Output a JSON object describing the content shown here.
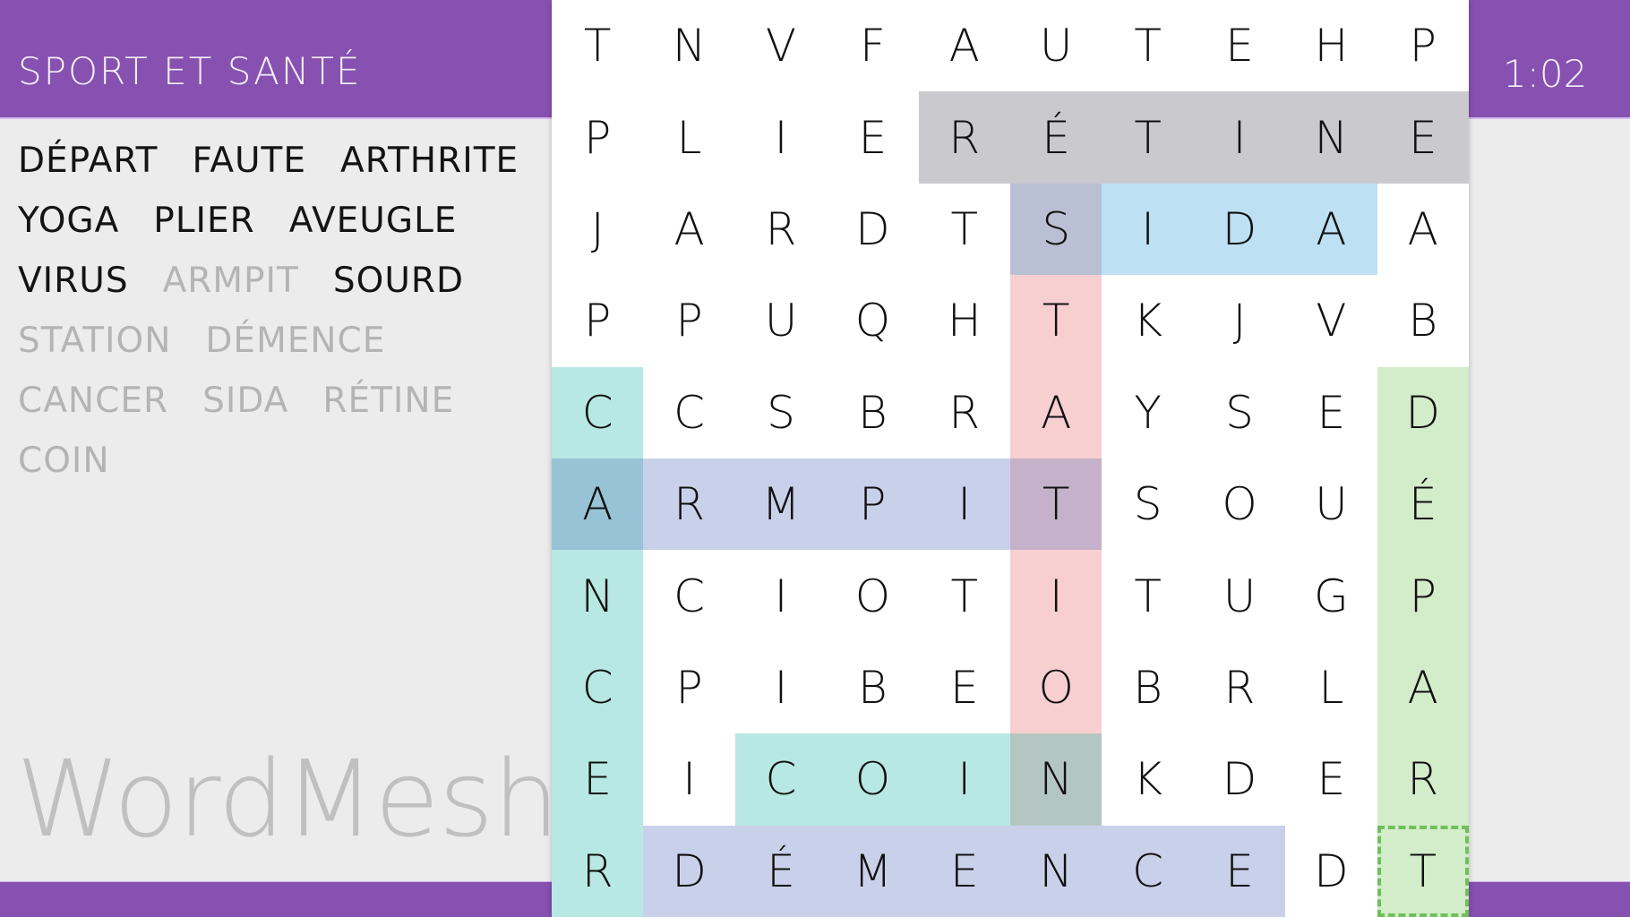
{
  "header": {
    "category_title": "SPORT ET SANTÉ",
    "timer": "1:02"
  },
  "logo": "WordMesh",
  "word_list": [
    [
      {
        "text": "DÉPART",
        "found": false
      },
      {
        "text": "FAUTE",
        "found": false
      },
      {
        "text": "ARTHRITE",
        "found": false
      }
    ],
    [
      {
        "text": "YOGA",
        "found": false
      },
      {
        "text": "PLIER",
        "found": false
      },
      {
        "text": "AVEUGLE",
        "found": false
      }
    ],
    [
      {
        "text": "VIRUS",
        "found": false
      },
      {
        "text": "ARMPIT",
        "found": true
      },
      {
        "text": "SOURD",
        "found": false
      }
    ],
    [
      {
        "text": "STATION",
        "found": true
      },
      {
        "text": "DÉMENCE",
        "found": true
      }
    ],
    [
      {
        "text": "CANCER",
        "found": true
      },
      {
        "text": "SIDA",
        "found": true
      },
      {
        "text": "RÉTINE",
        "found": true
      }
    ],
    [
      {
        "text": "COIN",
        "found": true
      }
    ]
  ],
  "grid": [
    [
      "T",
      "N",
      "V",
      "F",
      "A",
      "U",
      "T",
      "E",
      "H",
      "P"
    ],
    [
      "P",
      "L",
      "I",
      "E",
      "R",
      "É",
      "T",
      "I",
      "N",
      "E"
    ],
    [
      "J",
      "A",
      "R",
      "D",
      "T",
      "S",
      "I",
      "D",
      "A",
      "A"
    ],
    [
      "P",
      "P",
      "U",
      "Q",
      "H",
      "T",
      "K",
      "J",
      "V",
      "B"
    ],
    [
      "C",
      "C",
      "S",
      "B",
      "R",
      "A",
      "Y",
      "S",
      "E",
      "D"
    ],
    [
      "A",
      "R",
      "M",
      "P",
      "I",
      "T",
      "S",
      "O",
      "U",
      "É"
    ],
    [
      "N",
      "C",
      "I",
      "O",
      "T",
      "I",
      "T",
      "U",
      "G",
      "P"
    ],
    [
      "C",
      "P",
      "I",
      "B",
      "E",
      "O",
      "B",
      "R",
      "L",
      "A"
    ],
    [
      "E",
      "I",
      "C",
      "O",
      "I",
      "N",
      "K",
      "D",
      "E",
      "R"
    ],
    [
      "R",
      "D",
      "É",
      "M",
      "E",
      "N",
      "C",
      "E",
      "D",
      "T"
    ]
  ],
  "highlights": [
    {
      "word": "RÉTINE",
      "row": 1,
      "col": 4,
      "dir": "h",
      "len": 6,
      "color": "#c9c9ce"
    },
    {
      "word": "STATION",
      "row": 2,
      "col": 5,
      "dir": "v",
      "len": 7,
      "color": "#f8cfd1"
    },
    {
      "word": "SIDA",
      "row": 2,
      "col": 5,
      "dir": "h",
      "len": 4,
      "color": "#bde0f3"
    },
    {
      "word": "CANCER",
      "row": 4,
      "col": 0,
      "dir": "v",
      "len": 6,
      "color": "#b8e8e3"
    },
    {
      "word": "ARMPIT",
      "row": 5,
      "col": 0,
      "dir": "h",
      "len": 6,
      "color": "#c9d1ea"
    },
    {
      "word": "COIN",
      "row": 8,
      "col": 2,
      "dir": "h",
      "len": 4,
      "color": "#b8e8e3"
    },
    {
      "word": "DÉMENCE",
      "row": 9,
      "col": 1,
      "dir": "h",
      "len": 7,
      "color": "#c9d1ea"
    },
    {
      "word": "DÉPART",
      "row": 4,
      "col": 9,
      "dir": "v",
      "len": 6,
      "color": "#d3ecca"
    }
  ],
  "overlap_cells": [
    {
      "row": 2,
      "col": 5,
      "color": "#b9c0d3"
    },
    {
      "row": 5,
      "col": 0,
      "color": "#98c3d6"
    },
    {
      "row": 5,
      "col": 5,
      "color": "#c5b1c9"
    },
    {
      "row": 8,
      "col": 5,
      "color": "#b4c6c2"
    }
  ],
  "selection": {
    "row": 9,
    "col": 9
  }
}
